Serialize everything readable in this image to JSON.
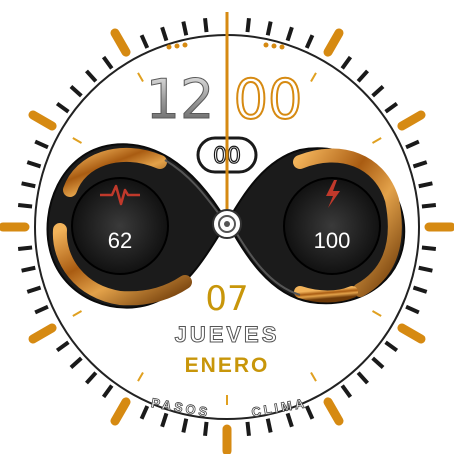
{
  "time": {
    "hours": "12",
    "minutes": "00",
    "seconds": "00"
  },
  "heart_rate": {
    "icon": "heartbeat-icon",
    "value": "62"
  },
  "battery": {
    "icon": "lightning-bolt-icon",
    "value": "100"
  },
  "date": {
    "day": "07",
    "weekday": "JUEVES",
    "month": "ENERO"
  },
  "shortcuts": {
    "left_label": "PASOS",
    "right_label": "CLIMA"
  },
  "colors": {
    "gold": "#d68a12",
    "dark": "#1a1a1a",
    "amber": "#8a4a0c",
    "silver": "#8c8c8c",
    "date_gold": "#c8960a",
    "icon_red": "#c0392b"
  }
}
